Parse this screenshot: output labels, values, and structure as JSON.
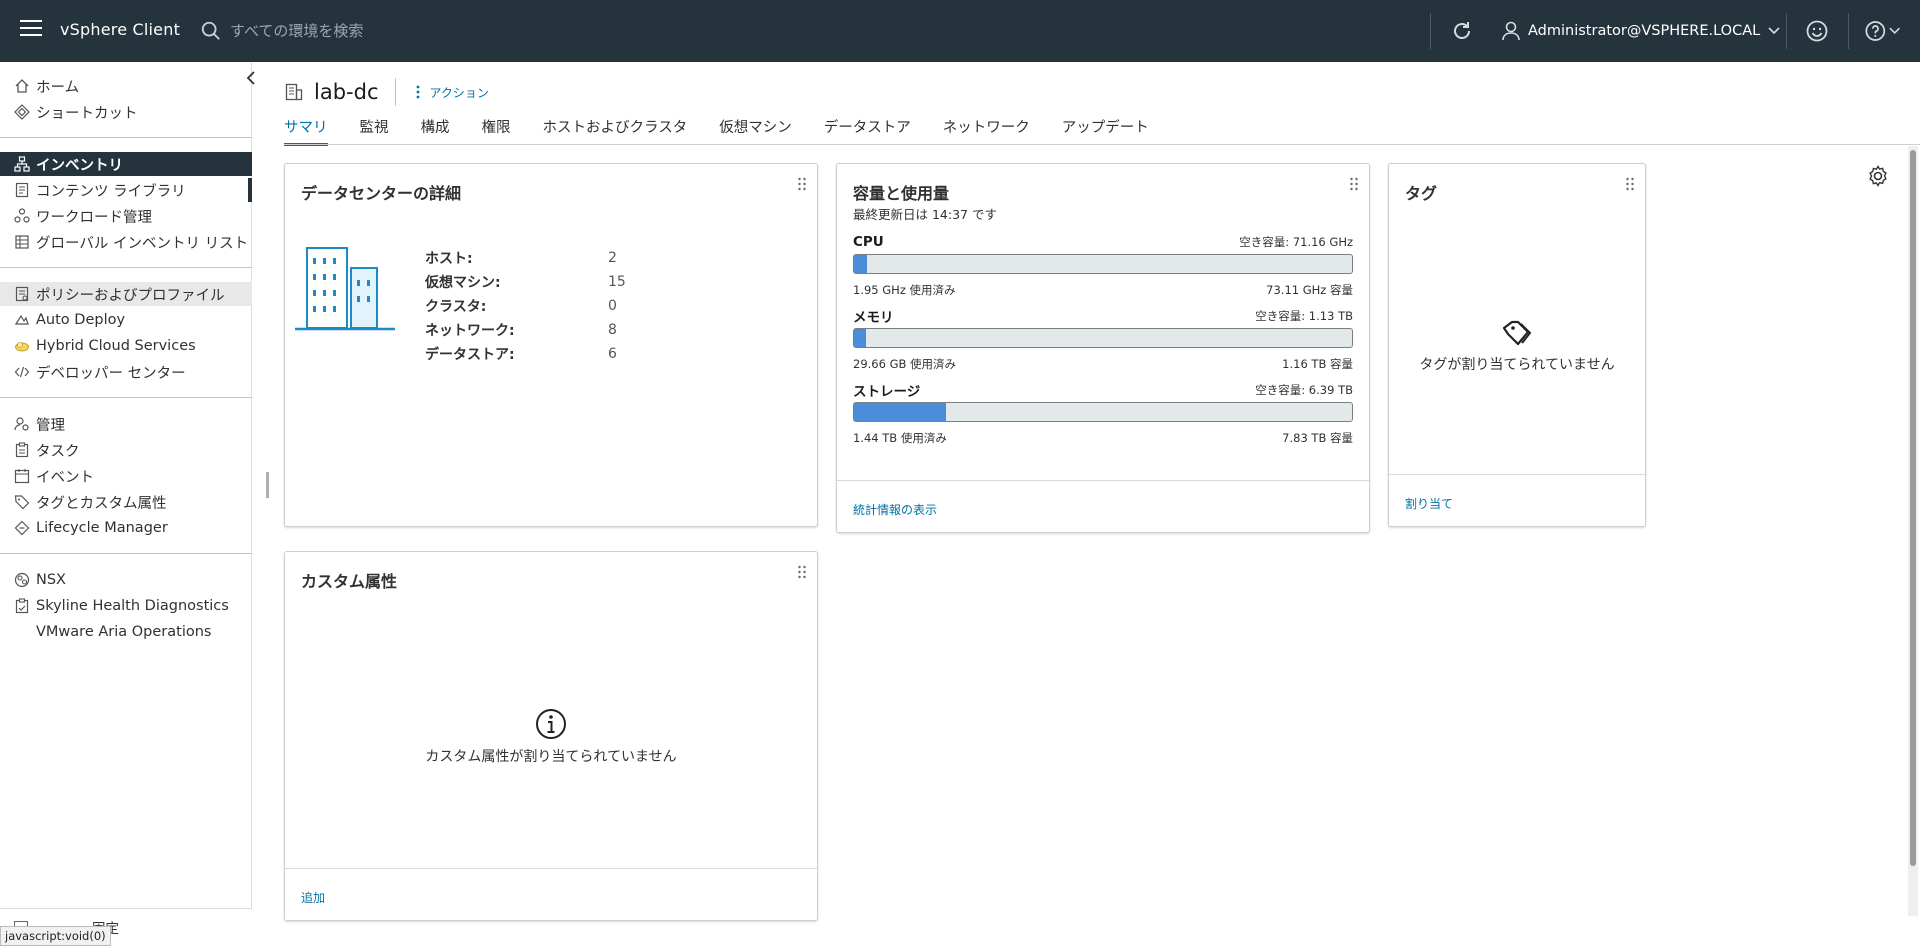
{
  "header": {
    "app_title": "vSphere Client",
    "search_placeholder": "すべての環境を検索",
    "user_label": "Administrator@VSPHERE.LOCAL"
  },
  "sidebar": {
    "items": [
      {
        "label": "ホーム",
        "icon": "home-icon"
      },
      {
        "label": "ショートカット",
        "icon": "shortcuts-icon"
      },
      {
        "label": "インベントリ",
        "icon": "inventory-icon"
      },
      {
        "label": "コンテンツ ライブラリ",
        "icon": "content-library-icon"
      },
      {
        "label": "ワークロード管理",
        "icon": "workload-icon"
      },
      {
        "label": "グローバル インベントリ リスト",
        "icon": "global-inventory-icon"
      },
      {
        "label": "ポリシーおよびプロファイル",
        "icon": "policy-icon"
      },
      {
        "label": "Auto Deploy",
        "icon": "auto-deploy-icon"
      },
      {
        "label": "Hybrid Cloud Services",
        "icon": "hybrid-cloud-icon"
      },
      {
        "label": "デベロッパー センター",
        "icon": "code-icon"
      },
      {
        "label": "管理",
        "icon": "admin-icon"
      },
      {
        "label": "タスク",
        "icon": "tasks-icon"
      },
      {
        "label": "イベント",
        "icon": "events-icon"
      },
      {
        "label": "タグとカスタム属性",
        "icon": "tag-icon"
      },
      {
        "label": "Lifecycle Manager",
        "icon": "lifecycle-icon"
      },
      {
        "label": "NSX",
        "icon": "nsx-icon"
      },
      {
        "label": "Skyline Health Diagnostics",
        "icon": "skyline-icon"
      },
      {
        "label": "VMware Aria Operations",
        "icon": ""
      }
    ],
    "footer_label": "固定",
    "status_tip": "javascript:void(0)"
  },
  "object": {
    "title": "lab-dc",
    "actions_label": "アクション",
    "tabs": [
      {
        "label": "サマリ",
        "active": true
      },
      {
        "label": "監視"
      },
      {
        "label": "構成"
      },
      {
        "label": "権限"
      },
      {
        "label": "ホストおよびクラスタ"
      },
      {
        "label": "仮想マシン"
      },
      {
        "label": "データストア"
      },
      {
        "label": "ネットワーク"
      },
      {
        "label": "アップデート"
      }
    ]
  },
  "details_card": {
    "title": "データセンターの詳細",
    "rows": [
      {
        "label": "ホスト:",
        "value": "2"
      },
      {
        "label": "仮想マシン:",
        "value": "15"
      },
      {
        "label": "クラスタ:",
        "value": "0"
      },
      {
        "label": "ネットワーク:",
        "value": "8"
      },
      {
        "label": "データストア:",
        "value": "6"
      }
    ]
  },
  "capacity_card": {
    "title": "容量と使用量",
    "subtitle": "最終更新日は 14:37 です",
    "resources": [
      {
        "name": "CPU",
        "free": "空き容量: 71.16 GHz",
        "used": "1.95 GHz 使用済み",
        "capacity": "73.11 GHz 容量",
        "fraction": 0.027
      },
      {
        "name": "メモリ",
        "free": "空き容量: 1.13 TB",
        "used": "29.66 GB 使用済み",
        "capacity": "1.16 TB 容量",
        "fraction": 0.025
      },
      {
        "name": "ストレージ",
        "free": "空き容量: 6.39 TB",
        "used": "1.44 TB 使用済み",
        "capacity": "7.83 TB 容量",
        "fraction": 0.184
      }
    ],
    "link": "統計情報の表示"
  },
  "tags_card": {
    "title": "タグ",
    "empty_text": "タグが割り当てられていません",
    "link": "割り当て"
  },
  "custom_attr_card": {
    "title": "カスタム属性",
    "empty_text": "カスタム属性が割り当てられていません",
    "link": "追加"
  },
  "colors": {
    "header_bg": "#25333d",
    "accent": "#0072a3",
    "bar_fill": "#4b8dd9"
  }
}
